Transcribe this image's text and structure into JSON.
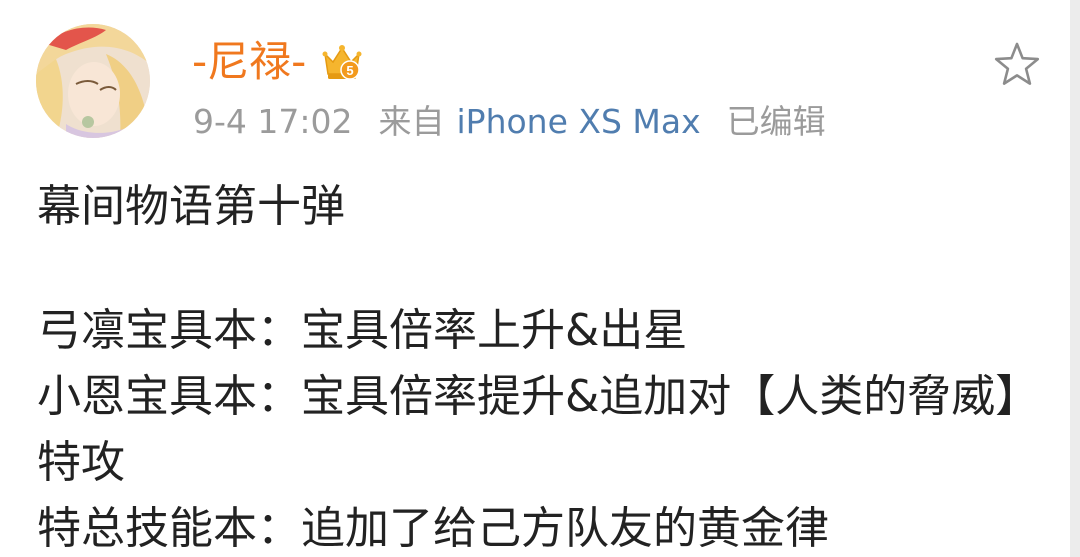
{
  "post": {
    "username": "-尼禄-",
    "vip_level": "5",
    "timestamp": "9-4 17:02",
    "from_label": "来自",
    "source": "iPhone XS Max",
    "edited_label": "已编辑",
    "lines": [
      "幕间物语第十弹",
      "弓凛宝具本：宝具倍率上升&出星",
      "小恩宝具本：宝具倍率提升&追加对【人类的脅威】特攻",
      "特总技能本：追加了给己方队友的黄金律"
    ]
  },
  "icons": {
    "avatar": "avatar-image",
    "badge": "vip-crown-icon",
    "favorite": "star-outline-icon"
  },
  "colors": {
    "username": "#f0781e",
    "meta": "#9b9b9b",
    "source_link": "#507daf",
    "text": "#222222",
    "badge": "#f5b52e"
  }
}
